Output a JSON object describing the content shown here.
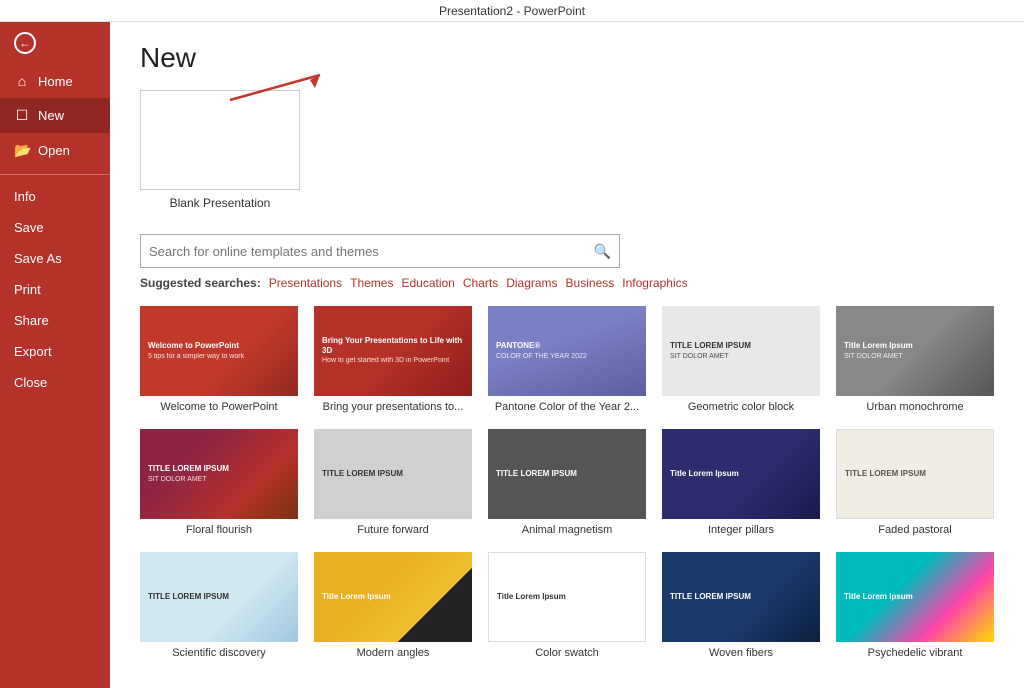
{
  "titleBar": {
    "text": "Presentation2 - PowerPoint"
  },
  "sidebar": {
    "back": "←",
    "items": [
      {
        "id": "home",
        "label": "Home",
        "icon": "⌂",
        "active": false
      },
      {
        "id": "new",
        "label": "New",
        "icon": "☐",
        "active": true
      }
    ],
    "open": {
      "label": "Open",
      "icon": "📂"
    },
    "textItems": [
      {
        "id": "info",
        "label": "Info"
      },
      {
        "id": "save",
        "label": "Save"
      },
      {
        "id": "save-as",
        "label": "Save As"
      },
      {
        "id": "print",
        "label": "Print"
      },
      {
        "id": "share",
        "label": "Share"
      },
      {
        "id": "export",
        "label": "Export"
      },
      {
        "id": "close",
        "label": "Close"
      }
    ]
  },
  "main": {
    "pageTitle": "New",
    "blankPresentation": {
      "label": "Blank Presentation"
    },
    "search": {
      "placeholder": "Search for online templates and themes",
      "searchIconLabel": "🔍"
    },
    "suggestedSearches": {
      "label": "Suggested searches:",
      "links": [
        "Presentations",
        "Themes",
        "Education",
        "Charts",
        "Diagrams",
        "Business",
        "Infographics"
      ]
    },
    "templates": [
      {
        "id": "welcome",
        "name": "Welcome to PowerPoint",
        "colorClass": "thumb-welcome",
        "textTop": "Welcome to PowerPoint",
        "textSub": "5 tips for a simpler way to work"
      },
      {
        "id": "3d",
        "name": "Bring your presentations to...",
        "colorClass": "thumb-3d",
        "textTop": "Bring Your Presentations to Life with 3D",
        "textSub": "How to get started with 3D in PowerPoint"
      },
      {
        "id": "pantone",
        "name": "Pantone Color of the Year 2...",
        "colorClass": "thumb-pantone",
        "textTop": "PANTONE®",
        "textSub": "COLOR OF THE YEAR 2022"
      },
      {
        "id": "geometric",
        "name": "Geometric color block",
        "colorClass": "thumb-geometric",
        "textTop": "TITLE LOREM IPSUM",
        "textSub": "SIT DOLOR AMET"
      },
      {
        "id": "urban",
        "name": "Urban monochrome",
        "colorClass": "thumb-urban",
        "textTop": "Title Lorem Ipsum",
        "textSub": "SIT DOLOR AMET"
      },
      {
        "id": "floral",
        "name": "Floral flourish",
        "colorClass": "thumb-floral",
        "textTop": "TITLE LOREM IPSUM",
        "textSub": "SIT DOLOR AMET"
      },
      {
        "id": "future",
        "name": "Future forward",
        "colorClass": "thumb-future",
        "textTop": "TITLE LOREM IPSUM",
        "textSub": ""
      },
      {
        "id": "animal",
        "name": "Animal magnetism",
        "colorClass": "thumb-animal",
        "textTop": "TITLE LOREM IPSUM",
        "textSub": ""
      },
      {
        "id": "integer",
        "name": "Integer pillars",
        "colorClass": "thumb-integer",
        "textTop": "Title Lorem Ipsum",
        "textSub": ""
      },
      {
        "id": "faded",
        "name": "Faded pastoral",
        "colorClass": "thumb-faded",
        "textTop": "TITLE LOREM IPSUM",
        "textSub": ""
      },
      {
        "id": "scientific",
        "name": "Scientific discovery",
        "colorClass": "thumb-scientific",
        "textTop": "TITLE LOREM IPSUM",
        "textSub": ""
      },
      {
        "id": "modern",
        "name": "Modern angles",
        "colorClass": "thumb-modern",
        "textTop": "Title Lorem Ipsum",
        "textSub": ""
      },
      {
        "id": "swatch",
        "name": "Color swatch",
        "colorClass": "thumb-swatch",
        "textTop": "Title Lorem Ipsum",
        "textSub": ""
      },
      {
        "id": "woven",
        "name": "Woven fibers",
        "colorClass": "thumb-woven",
        "textTop": "TITLE LOREM IPSUM",
        "textSub": ""
      },
      {
        "id": "psychedelic",
        "name": "Psychedelic vibrant",
        "colorClass": "thumb-psychedelic",
        "textTop": "Title Lorem Ipsum",
        "textSub": ""
      }
    ]
  }
}
